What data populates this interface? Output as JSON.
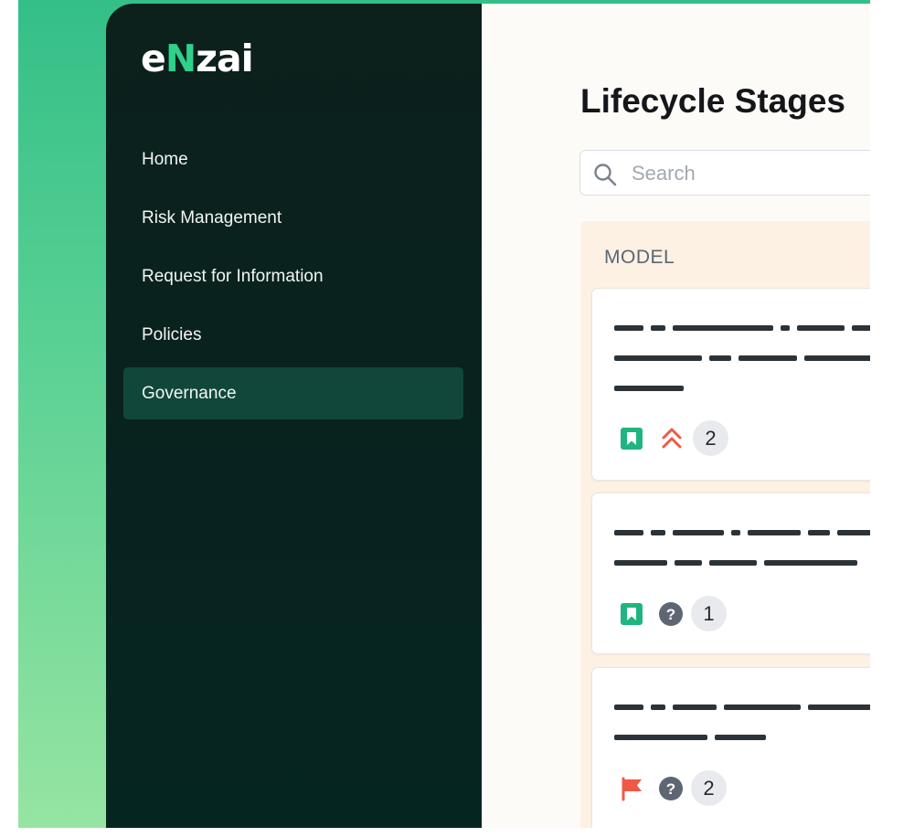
{
  "logo": {
    "prefix": "e",
    "accent": "N",
    "suffix": "zai"
  },
  "nav": {
    "items": [
      {
        "label": "Home"
      },
      {
        "label": "Risk Management"
      },
      {
        "label": "Request for Information"
      },
      {
        "label": "Policies"
      },
      {
        "label": "Governance",
        "active": true
      }
    ]
  },
  "page": {
    "title": "Lifecycle Stages"
  },
  "search": {
    "placeholder": "Search",
    "value": ""
  },
  "column": {
    "title": "MODEL",
    "cards": [
      {
        "status_icon": "bookmark-icon",
        "priority_icon": "chevrons-up-icon",
        "count": "2"
      },
      {
        "status_icon": "bookmark-icon",
        "priority_icon": "help-circle-icon",
        "count": "1"
      },
      {
        "status_icon": "flag-icon",
        "priority_icon": "help-circle-icon",
        "count": "2"
      }
    ]
  },
  "colors": {
    "brand_green": "#2fd18a",
    "sidebar_bg": "#052521",
    "active_nav": "#11473a",
    "bookmark_green": "#20b57e",
    "alert_red": "#ee5a46",
    "neutral_icon": "#5d6672"
  }
}
